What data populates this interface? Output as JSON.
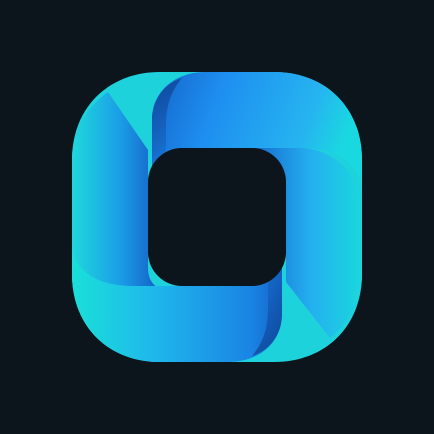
{
  "app": {
    "icon": "interlocking-ribbon-rounded-square-logo-icon"
  },
  "colors": {
    "background": "#0c141c",
    "aqua": "#19e0d8",
    "cyan": "#22b8f0",
    "blue_light": "#2a9cf0",
    "blue_deep": "#1668cc"
  }
}
